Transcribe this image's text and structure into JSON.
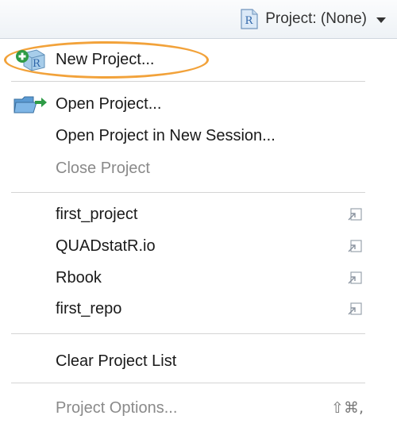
{
  "topbar": {
    "project_label": "Project: (None)",
    "icon": "r-document-icon"
  },
  "menu": {
    "new_project": {
      "label": "New Project...",
      "icon": "new-r-project-icon"
    },
    "open_project": {
      "label": "Open Project...",
      "icon": "open-folder-icon"
    },
    "open_project_new_session": {
      "label": "Open Project in New Session..."
    },
    "close_project": {
      "label": "Close Project",
      "disabled": true
    },
    "recent_projects": [
      {
        "label": "first_project",
        "icon": "open-in-new-window-icon"
      },
      {
        "label": "QUADstatR.io",
        "icon": "open-in-new-window-icon"
      },
      {
        "label": "Rbook",
        "icon": "open-in-new-window-icon"
      },
      {
        "label": "first_repo",
        "icon": "open-in-new-window-icon"
      }
    ],
    "clear_project_list": {
      "label": "Clear Project List"
    },
    "project_options": {
      "label": "Project Options...",
      "shortcut": "⇧⌘,",
      "disabled": true
    }
  },
  "colors": {
    "highlight": "#f2a23a",
    "disabled_text": "#8a8a8a",
    "separator": "#d4d4d4"
  }
}
